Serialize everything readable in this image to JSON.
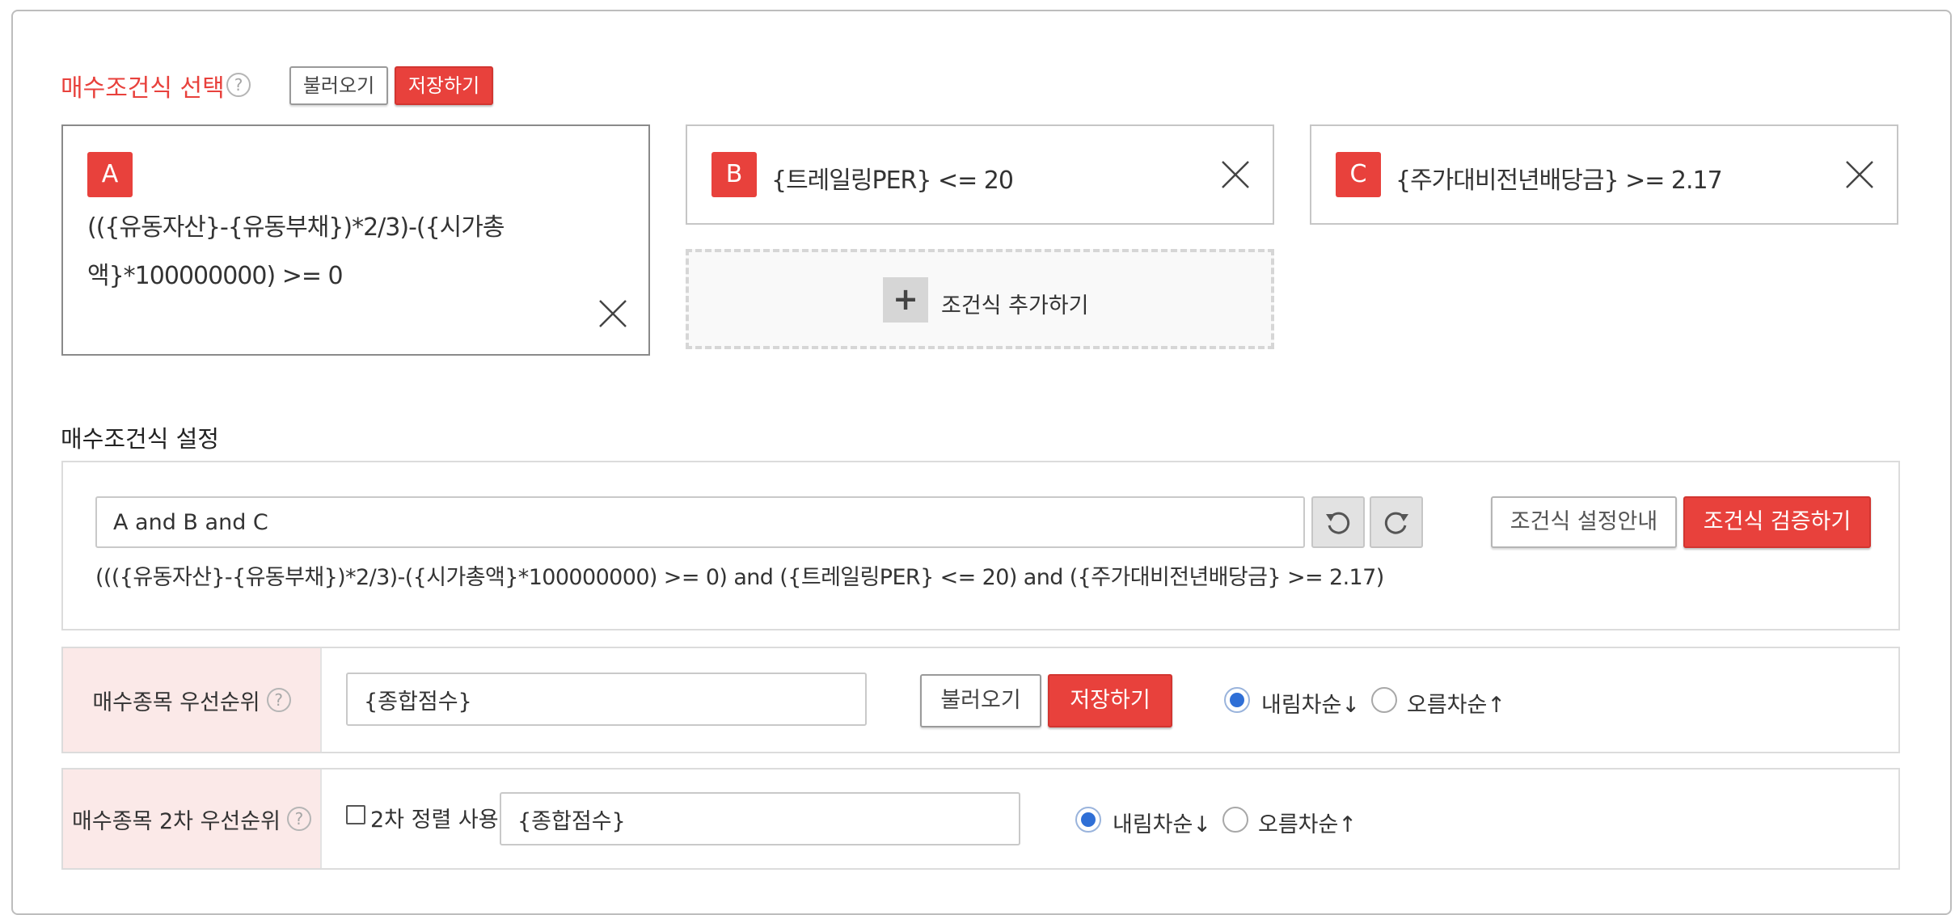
{
  "buy_condition_select": {
    "title": "매수조건식 선택",
    "help": "?",
    "load_label": "불러오기",
    "save_label": "저장하기"
  },
  "conditions": [
    {
      "letter": "A",
      "line1": "(({유동자산}-{유동부채})*2/3)-({시가총",
      "line2": "액}*100000000) >= 0"
    },
    {
      "letter": "B",
      "text": "{트레일링PER} <= 20"
    },
    {
      "letter": "C",
      "text": "{주가대비전년배당금} >= 2.17"
    }
  ],
  "add_condition": {
    "plus": "+",
    "label": "조건식 추가하기"
  },
  "buy_condition_setting": {
    "title": "매수조건식 설정",
    "expression_value": "A and B and C",
    "expanded": "((({유동자산}-{유동부채})*2/3)-({시가총액}*100000000) >= 0) and ({트레일링PER} <= 20) and ({주가대비전년배당금} >= 2.17)",
    "guide_label": "조건식 설정안내",
    "validate_label": "조건식 검증하기"
  },
  "priority": {
    "label": "매수종목 우선순위",
    "help": "?",
    "value": "{종합점수}",
    "load_label": "불러오기",
    "save_label": "저장하기",
    "desc_label": "내림차순↓",
    "asc_label": "오름차순↑",
    "selected": "desc"
  },
  "priority2": {
    "label": "매수종목 2차 우선순위",
    "help": "?",
    "checkbox_label": "2차 정렬 사용",
    "value": "{종합점수}",
    "desc_label": "내림차순↓",
    "asc_label": "오름차순↑",
    "selected": "desc"
  },
  "colors": {
    "accent": "#e8413c",
    "row_label_bg": "#fbe9e8",
    "radio_on": "#2f6fd6"
  }
}
